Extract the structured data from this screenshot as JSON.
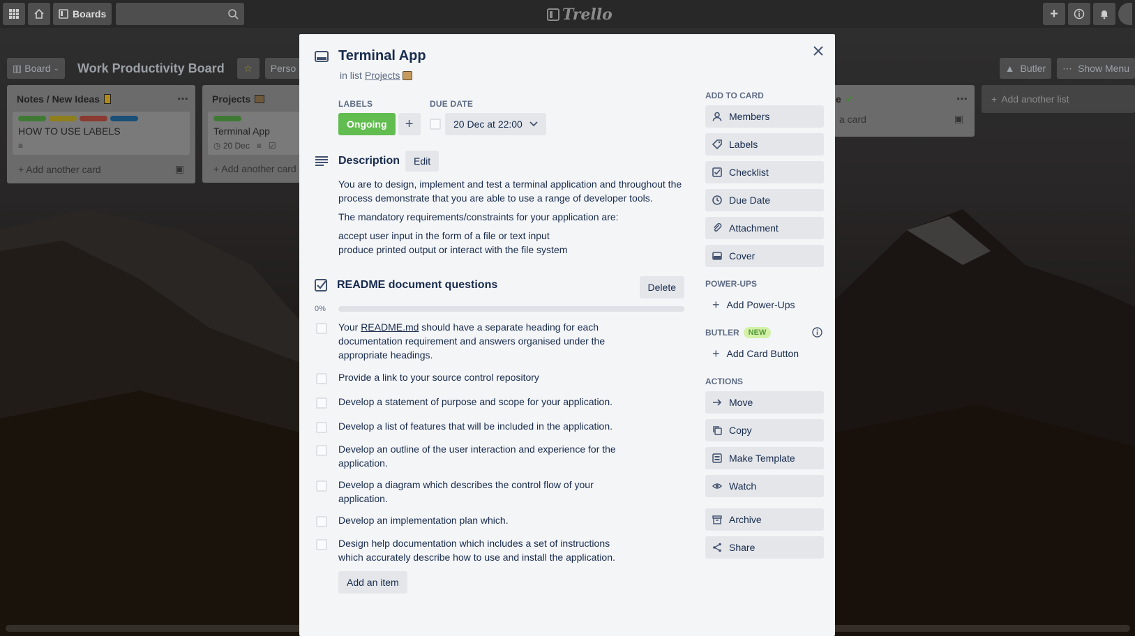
{
  "header": {
    "boards_label": "Boards",
    "logo_text": "Trello"
  },
  "board": {
    "view_label": "Board",
    "title": "Work Productivity Board",
    "visibility_label": "Perso",
    "butler_label": "Butler",
    "show_menu_label": "Show Menu",
    "add_list_label": "Add another list"
  },
  "lists": [
    {
      "title": "Notes / New Ideas",
      "card": {
        "title": "HOW TO USE LABELS",
        "label_colors": [
          "#61bd4f",
          "#f2d600",
          "#eb5a46",
          "#0079bf"
        ]
      },
      "add_card_label": "Add another card"
    },
    {
      "title": "Projects",
      "card": {
        "title": "Terminal App",
        "label_colors": [
          "#61bd4f"
        ],
        "due": "20 Dec"
      },
      "add_card_label": "Add another card"
    },
    {
      "title_fragment": "e",
      "card_fragment": "a card"
    }
  ],
  "modal": {
    "card_title": "Terminal App",
    "in_list_prefix": "in list",
    "list_name": "Projects",
    "labels_heading": "LABELS",
    "label_name": "Ongoing",
    "label_color": "#61bd4f",
    "due_heading": "DUE DATE",
    "due_value": "20 Dec at 22:00",
    "description_heading": "Description",
    "edit_label": "Edit",
    "description": [
      "You are to design, implement and test a terminal application and throughout the process demonstrate that you are able to use a range of developer tools.",
      "The mandatory requirements/constraints for your application are:",
      "accept user input in the form of a file or text input",
      "produce printed output or interact with the file system"
    ],
    "checklist_title": "README document questions",
    "delete_label": "Delete",
    "progress_percent": "0%",
    "progress_value": 0,
    "checklist_items": [
      {
        "prefix": "Your ",
        "link": "README.md",
        "text": " should have a separate heading for each documentation requirement and answers organised under the appropriate headings."
      },
      {
        "text": "Provide a link to your source control repository"
      },
      {
        "text": "Develop a statement of purpose and scope for your application."
      },
      {
        "text": "Develop a list of features that will be included in the application."
      },
      {
        "text": "Develop an outline of the user interaction and experience for the application."
      },
      {
        "text": "Develop a diagram which describes the control flow of your application."
      },
      {
        "text": "Develop an implementation plan which."
      },
      {
        "text": "Design help documentation which includes a set of instructions which accurately describe how to use and install the application."
      }
    ],
    "add_item_label": "Add an item"
  },
  "sidebar": {
    "add_to_card_heading": "ADD TO CARD",
    "add_to_card": [
      {
        "label": "Members",
        "icon": "person-icon"
      },
      {
        "label": "Labels",
        "icon": "tag-icon"
      },
      {
        "label": "Checklist",
        "icon": "checkbox-icon"
      },
      {
        "label": "Due Date",
        "icon": "clock-icon"
      },
      {
        "label": "Attachment",
        "icon": "paperclip-icon"
      },
      {
        "label": "Cover",
        "icon": "cover-icon"
      }
    ],
    "power_ups_heading": "POWER-UPS",
    "add_power_ups_label": "Add Power-Ups",
    "butler_heading": "BUTLER",
    "new_badge": "NEW",
    "add_card_button_label": "Add Card Button",
    "actions_heading": "ACTIONS",
    "actions": [
      {
        "label": "Move",
        "icon": "arrow-right-icon"
      },
      {
        "label": "Copy",
        "icon": "copy-icon"
      },
      {
        "label": "Make Template",
        "icon": "template-icon"
      },
      {
        "label": "Watch",
        "icon": "eye-icon"
      },
      {
        "label": "Archive",
        "icon": "archive-icon"
      },
      {
        "label": "Share",
        "icon": "share-icon"
      }
    ]
  }
}
